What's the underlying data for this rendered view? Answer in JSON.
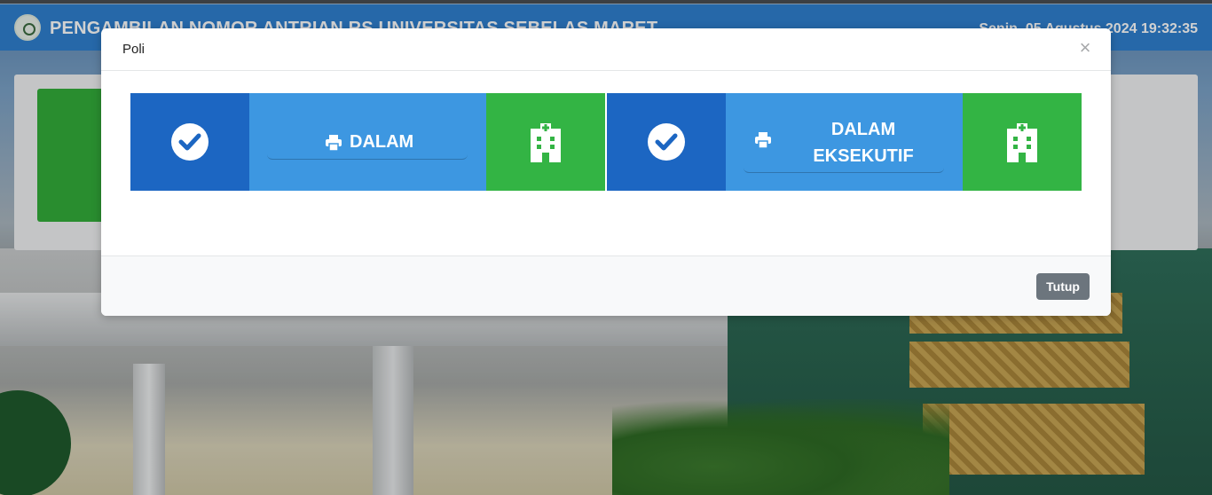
{
  "header": {
    "title": "PENGAMBILAN NOMOR ANTRIAN RS UNIVERSITAS SEBELAS MARET",
    "datetime": "Senin, 05 Agustus 2024 19:32:35"
  },
  "modal": {
    "title": "Poli",
    "close_symbol": "×",
    "footer_button": "Tutup",
    "cards": [
      {
        "label_line1": "DALAM",
        "label_line2": "",
        "check_icon": "check-circle-icon",
        "print_icon": "printer-icon",
        "side_icon": "hospital-icon"
      },
      {
        "label_line1": "DALAM",
        "label_line2": "EKSEKUTIF",
        "check_icon": "check-circle-icon",
        "print_icon": "printer-icon",
        "side_icon": "hospital-icon"
      }
    ]
  },
  "colors": {
    "header_bg": "#2f7fcf",
    "check_bg": "#1c66c2",
    "mid_bg": "#3d97e1",
    "hospital_bg": "#33b444",
    "footer_button_bg": "#6c757d"
  }
}
